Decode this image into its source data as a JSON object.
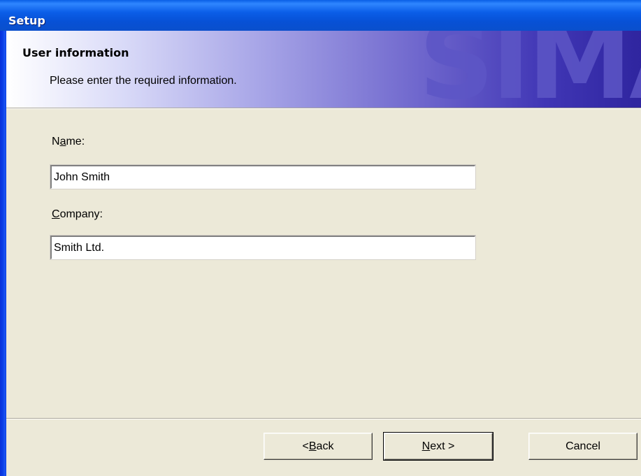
{
  "window": {
    "title": "Setup"
  },
  "banner": {
    "title": "User information",
    "subtitle": "Please enter the required information.",
    "watermark": "SIMA"
  },
  "form": {
    "name": {
      "label_pre": "N",
      "label_accel": "a",
      "label_post": "me:",
      "value": "John Smith"
    },
    "company": {
      "label_pre": "",
      "label_accel": "C",
      "label_post": "ompany:",
      "value": "Smith Ltd."
    }
  },
  "buttons": {
    "back": {
      "pre": "< ",
      "accel": "B",
      "post": "ack"
    },
    "next": {
      "pre": "",
      "accel": "N",
      "post": "ext >"
    },
    "cancel": {
      "label": "Cancel"
    }
  }
}
